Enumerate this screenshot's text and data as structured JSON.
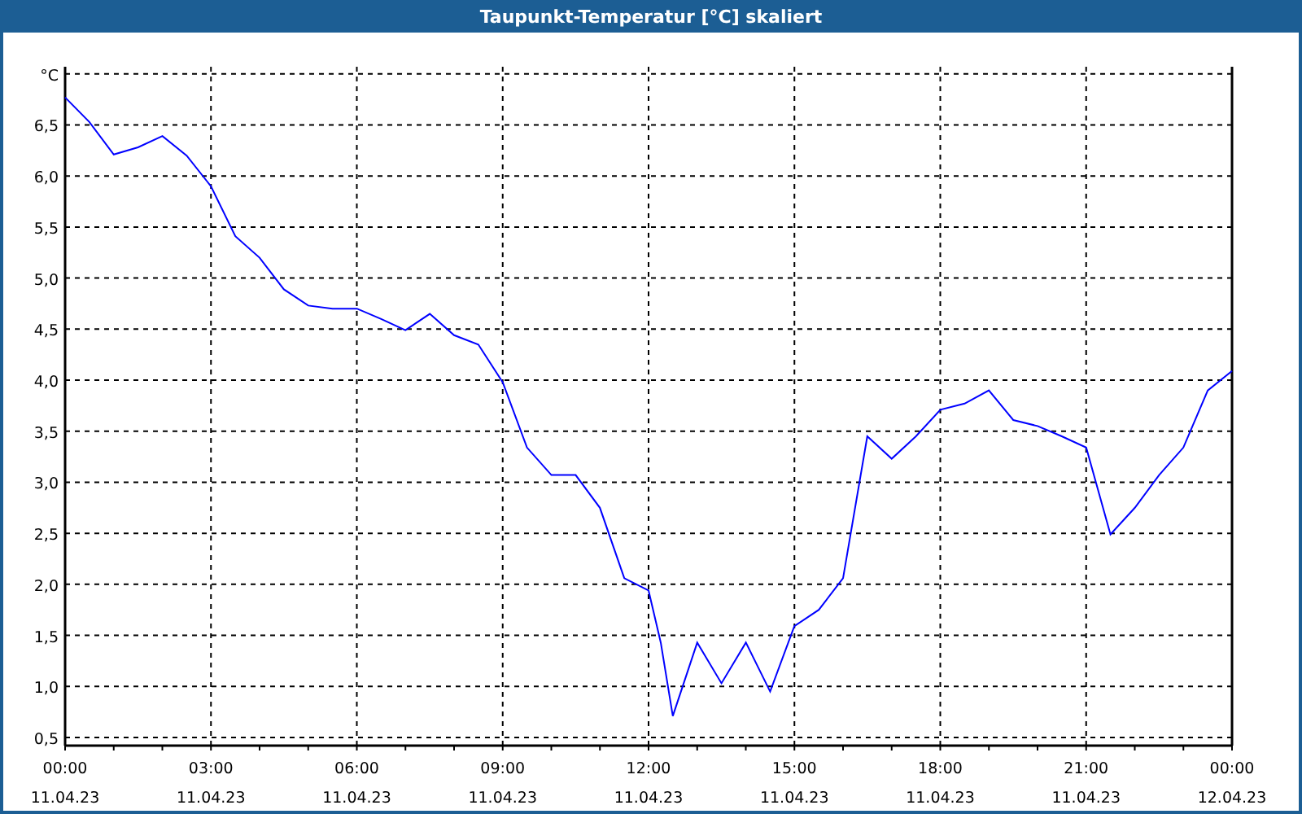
{
  "window": {
    "title": "Taupunkt-Temperatur [°C] skaliert"
  },
  "chart": {
    "x_axis_dates": [
      "11.04.23",
      "11.04.23",
      "11.04.23",
      "11.04.23",
      "11.04.23",
      "11.04.23",
      "11.04.23",
      "11.04.23",
      "12.04.23"
    ],
    "chart_data": {
      "type": "line",
      "xlim": [
        0,
        24
      ],
      "ylim": [
        0.42,
        7.07
      ],
      "xticks": [
        {
          "value": 0,
          "label": "00:00"
        },
        {
          "value": 3,
          "label": "03:00"
        },
        {
          "value": 6,
          "label": "06:00"
        },
        {
          "value": 9,
          "label": "09:00"
        },
        {
          "value": 12,
          "label": "12:00"
        },
        {
          "value": 15,
          "label": "15:00"
        },
        {
          "value": 18,
          "label": "18:00"
        },
        {
          "value": 21,
          "label": "21:00"
        },
        {
          "value": 24,
          "label": "00:00"
        }
      ],
      "yticks": [
        {
          "value": 0.5,
          "label": "0,5"
        },
        {
          "value": 1,
          "label": "1,0"
        },
        {
          "value": 1.5,
          "label": "1,5"
        },
        {
          "value": 2,
          "label": "2,0"
        },
        {
          "value": 2.5,
          "label": "2,5"
        },
        {
          "value": 3,
          "label": "3,0"
        },
        {
          "value": 3.5,
          "label": "3,5"
        },
        {
          "value": 4,
          "label": "4,0"
        },
        {
          "value": 4.5,
          "label": "4,5"
        },
        {
          "value": 5,
          "label": "5,0"
        },
        {
          "value": 5.5,
          "label": "5,5"
        },
        {
          "value": 6,
          "label": "6,0"
        },
        {
          "value": 6.5,
          "label": "6,5"
        },
        {
          "value": 7,
          "label": "°C"
        }
      ],
      "x": [
        0,
        0.5,
        1,
        1.5,
        2,
        2.5,
        3,
        3.5,
        4,
        4.5,
        5,
        5.5,
        6,
        6.5,
        7,
        7.5,
        8,
        8.5,
        9,
        9.5,
        10,
        10.5,
        11,
        11.5,
        12,
        12.25,
        12.5,
        13,
        13.5,
        14,
        14.5,
        15,
        15.5,
        16,
        16.5,
        17,
        17.5,
        18,
        18.5,
        19,
        19.5,
        20,
        20.5,
        21,
        21.5,
        22,
        22.5,
        23,
        23.5,
        24
      ],
      "grid": true,
      "series": [
        {
          "color": "#0000ff",
          "values": [
            6.77,
            6.53,
            6.21,
            6.28,
            6.39,
            6.2,
            5.9,
            5.41,
            5.2,
            4.89,
            4.73,
            4.7,
            4.7,
            4.6,
            4.49,
            4.65,
            4.44,
            4.35,
            3.98,
            3.34,
            3.07,
            3.07,
            2.75,
            2.06,
            1.94,
            1.43,
            0.71,
            1.43,
            1.03,
            1.43,
            0.95,
            1.59,
            1.75,
            2.06,
            3.45,
            3.23,
            3.45,
            3.71,
            3.77,
            3.9,
            3.61,
            3.55,
            3.45,
            3.34,
            2.49,
            2.75,
            3.07,
            3.34,
            3.9,
            4.09
          ]
        }
      ]
    }
  }
}
